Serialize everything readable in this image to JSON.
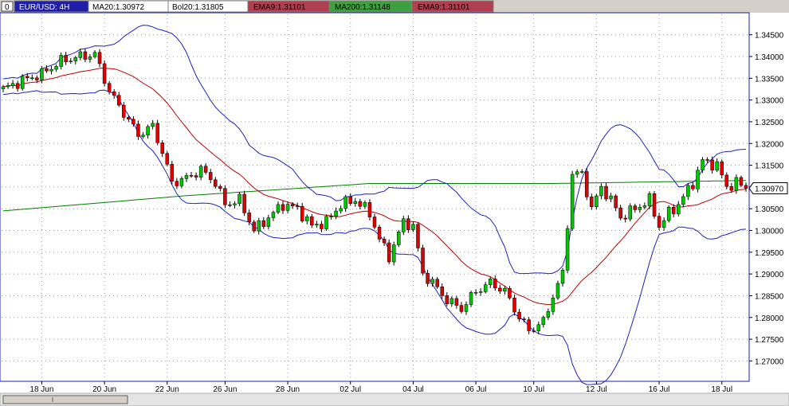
{
  "header": {
    "symbol_label": "EUR/USD: 4H",
    "ma20_label": "MA20:1.30972",
    "bol20_label": "Bol20:1.31805",
    "ema9_label_a": "EMA9:1.31101",
    "ma200_label": "MA200:1.31148",
    "ema9_label_b": "EMA9:1.31101"
  },
  "colors": {
    "up_candle": "#00c800",
    "down_candle": "#e00000",
    "bollinger": "#2020c0",
    "ma20": "#c00000",
    "ma200": "#008000",
    "grid": "#9a9a9a",
    "header_red": "#b04050",
    "header_green": "#40a040"
  },
  "price_tag": "1.30970",
  "chart_data": {
    "type": "candlestick",
    "x_labels": [
      "18 Jun",
      "20 Jun",
      "22 Jun",
      "26 Jun",
      "28 Jun",
      "02 Jul",
      "04 Jul",
      "06 Jul",
      "10 Jul",
      "12 Jul",
      "16 Jul",
      "18 Jul"
    ],
    "y_ticks": [
      "1.34500",
      "1.34000",
      "1.33500",
      "1.33000",
      "1.32500",
      "1.32000",
      "1.31500",
      "1.31000",
      "1.30500",
      "1.30000",
      "1.29500",
      "1.29000",
      "1.28500",
      "1.28000",
      "1.27500",
      "1.27000"
    ],
    "ylim": [
      1.2655,
      1.3497
    ],
    "grid": true,
    "candle_close_anchors": [
      [
        0,
        1.3325
      ],
      [
        4,
        1.3345
      ],
      [
        8,
        1.336
      ],
      [
        12,
        1.339
      ],
      [
        16,
        1.34
      ],
      [
        19,
        1.3405
      ],
      [
        22,
        1.332
      ],
      [
        25,
        1.327
      ],
      [
        28,
        1.322
      ],
      [
        31,
        1.324
      ],
      [
        33,
        1.318
      ],
      [
        35,
        1.311
      ],
      [
        38,
        1.312
      ],
      [
        41,
        1.314
      ],
      [
        44,
        1.311
      ],
      [
        46,
        1.306
      ],
      [
        49,
        1.307
      ],
      [
        52,
        1.3
      ],
      [
        55,
        1.303
      ],
      [
        58,
        1.306
      ],
      [
        61,
        1.305
      ],
      [
        64,
        1.301
      ],
      [
        67,
        1.302
      ],
      [
        70,
        1.306
      ],
      [
        73,
        1.307
      ],
      [
        76,
        1.304
      ],
      [
        78,
        1.298
      ],
      [
        80,
        1.294
      ],
      [
        83,
        1.302
      ],
      [
        85,
        1.301
      ],
      [
        87,
        1.29
      ],
      [
        89,
        1.288
      ],
      [
        92,
        1.284
      ],
      [
        95,
        1.282
      ],
      [
        98,
        1.286
      ],
      [
        101,
        1.288
      ],
      [
        104,
        1.286
      ],
      [
        107,
        1.28
      ],
      [
        109,
        1.277
      ],
      [
        112,
        1.279
      ],
      [
        114,
        1.285
      ],
      [
        116,
        1.29
      ],
      [
        118,
        1.313
      ],
      [
        120,
        1.313
      ],
      [
        122,
        1.305
      ],
      [
        124,
        1.31
      ],
      [
        126,
        1.307
      ],
      [
        128,
        1.303
      ],
      [
        131,
        1.305
      ],
      [
        134,
        1.307
      ],
      [
        136,
        1.301
      ],
      [
        138,
        1.304
      ],
      [
        140,
        1.306
      ],
      [
        143,
        1.311
      ],
      [
        145,
        1.316
      ],
      [
        148,
        1.315
      ],
      [
        150,
        1.31
      ],
      [
        152,
        1.311
      ],
      [
        154,
        1.3097
      ]
    ],
    "ma200_anchors": [
      [
        0,
        1.3045
      ],
      [
        38,
        1.308
      ],
      [
        76,
        1.3108
      ],
      [
        114,
        1.3108
      ],
      [
        154,
        1.3115
      ]
    ],
    "last_price": 1.3097
  }
}
